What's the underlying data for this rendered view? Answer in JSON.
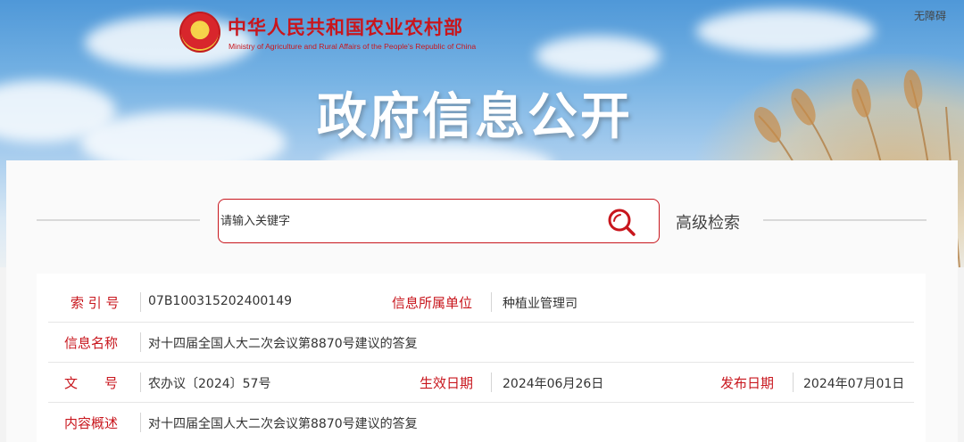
{
  "header": {
    "ministry_name_cn": "中华人民共和国农业农村部",
    "ministry_name_en": "Ministry of Agriculture and Rural Affairs of the People's Republic of China",
    "accessibility_link": "无障碍",
    "banner_title": "政府信息公开"
  },
  "search": {
    "placeholder": "请输入关键字",
    "advanced_label": "高级检索"
  },
  "info": {
    "index_label": "索 引 号",
    "index_value": "07B100315202400149",
    "unit_label": "信息所属单位",
    "unit_value": "种植业管理司",
    "name_label": "信息名称",
    "name_value": "对十四届全国人大二次会议第8870号建议的答复",
    "doc_label": "文　　号",
    "doc_value": "农办议〔2024〕57号",
    "effective_label": "生效日期",
    "effective_value": "2024年06月26日",
    "publish_label": "发布日期",
    "publish_value": "2024年07月01日",
    "summary_label": "内容概述",
    "summary_value": "对十四届全国人大二次会议第8870号建议的答复"
  },
  "colors": {
    "accent_red": "#c8161d",
    "sky_blue": "#4f98d8"
  }
}
